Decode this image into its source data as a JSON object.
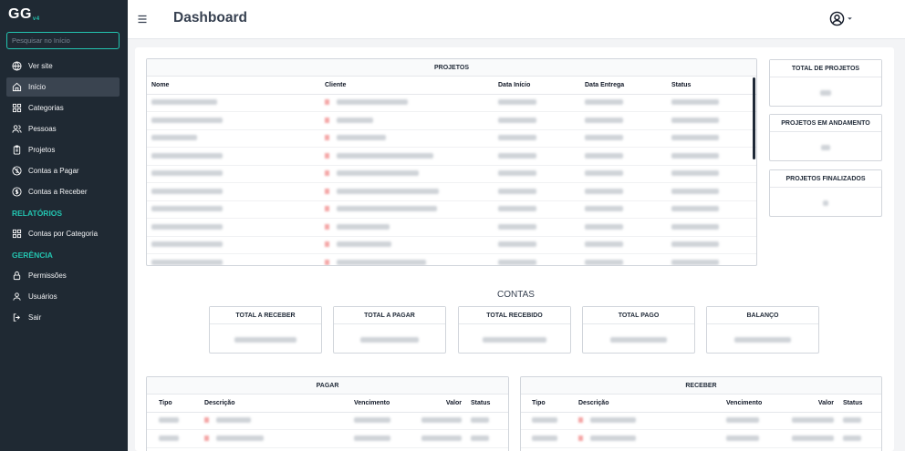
{
  "app": {
    "logo": "GG",
    "logo_version": "v4"
  },
  "search": {
    "placeholder": "Pesquisar no Início"
  },
  "sidebar": {
    "items": [
      {
        "label": "Ver site",
        "icon": "globe-icon"
      },
      {
        "label": "Início",
        "icon": "home-icon"
      },
      {
        "label": "Categorias",
        "icon": "grid-icon"
      },
      {
        "label": "Pessoas",
        "icon": "users-icon"
      },
      {
        "label": "Projetos",
        "icon": "clipboard-icon"
      },
      {
        "label": "Contas a Pagar",
        "icon": "no-money-icon"
      },
      {
        "label": "Contas a Receber",
        "icon": "dollar-circle-icon"
      }
    ],
    "section_reports": "RELATÓRIOS",
    "reports_items": [
      {
        "label": "Contas por Categoria",
        "icon": "grid-icon"
      }
    ],
    "section_management": "GERÊNCIA",
    "management_items": [
      {
        "label": "Permissões",
        "icon": "lock-icon"
      },
      {
        "label": "Usuários",
        "icon": "user-icon"
      },
      {
        "label": "Sair",
        "icon": "logout-icon"
      }
    ]
  },
  "header": {
    "title": "Dashboard"
  },
  "projects": {
    "title": "PROJETOS",
    "columns": [
      "Nome",
      "Cliente",
      "Data Início",
      "Data Entrega",
      "Status"
    ]
  },
  "stats": {
    "total": "TOTAL DE PROJETOS",
    "in_progress": "PROJETOS EM ANDAMENTO",
    "finished": "PROJETOS FINALIZADOS"
  },
  "accounts": {
    "title": "CONTAS",
    "cards": [
      "TOTAL A RECEBER",
      "TOTAL A PAGAR",
      "TOTAL RECEBIDO",
      "TOTAL PAGO",
      "BALANÇO"
    ]
  },
  "pay": {
    "title": "PAGAR",
    "columns": [
      "Tipo",
      "Descrição",
      "Vencimento",
      "Valor",
      "Status"
    ]
  },
  "receive": {
    "title": "RECEBER",
    "columns": [
      "Tipo",
      "Descrição",
      "Vencimento",
      "Valor",
      "Status"
    ]
  },
  "colors": {
    "accent": "#23c4b0",
    "sidebar_bg": "#1f2933"
  }
}
